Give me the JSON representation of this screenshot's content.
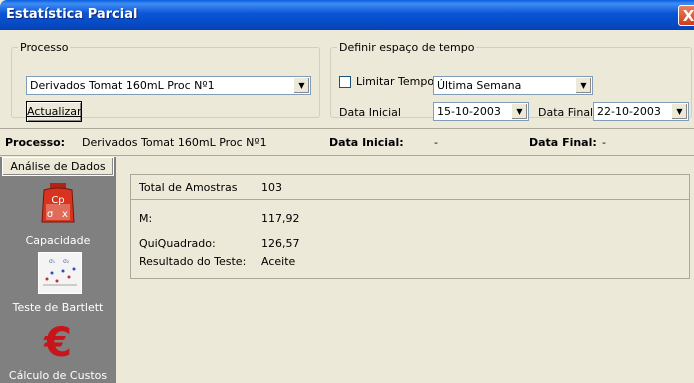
{
  "window": {
    "title": "Estatística Parcial",
    "close_label": "X"
  },
  "processo": {
    "legend": "Processo",
    "selected": "Derivados Tomat 160mL Proc Nº1",
    "button_label": "Actualizar"
  },
  "tempo": {
    "legend": "Definir espaço de tempo",
    "limit_label": "Limitar Tempo",
    "limit_checked": false,
    "period_selected": "Última Semana",
    "start_label": "Data Inicial",
    "start_value": "15-10-2003",
    "end_label": "Data Final",
    "end_value": "22-10-2003"
  },
  "info": {
    "process_label": "Processo:",
    "process_value": "Derivados Tomat 160mL Proc Nº1",
    "start_label": "Data Inicial:",
    "start_value": "-",
    "end_label": "Data Final:",
    "end_value": "-"
  },
  "sidebar": {
    "header": "Análise de Dados",
    "items": [
      {
        "label": "Capacidade",
        "icon": "capacity-icon"
      },
      {
        "label": "Teste de Bartlett",
        "icon": "bartlett-chart-icon"
      },
      {
        "label": "Cálculo de Custos",
        "icon": "euro-icon"
      }
    ]
  },
  "results": {
    "samples_label": "Total de Amostras",
    "samples_value": "103",
    "rows": [
      {
        "label": "M:",
        "value": "117,92"
      },
      {
        "label": "QuiQuadrado:",
        "value": "126,57"
      },
      {
        "label": "Resultado do Teste:",
        "value": "Aceite"
      }
    ]
  }
}
